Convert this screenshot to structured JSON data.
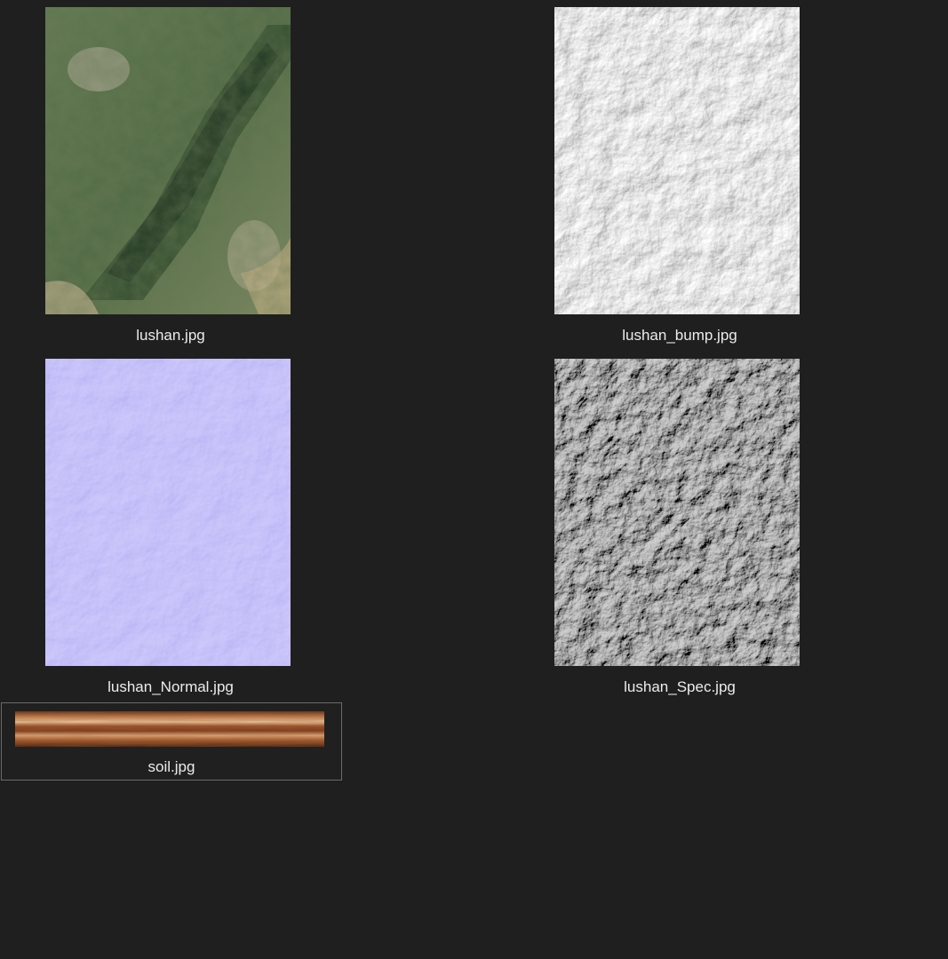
{
  "files": [
    {
      "name": "lushan.jpg",
      "thumbnail": "satellite terrain image",
      "selected": false
    },
    {
      "name": "lushan_bump.jpg",
      "thumbnail": "grayscale bump map",
      "selected": false
    },
    {
      "name": "lushan_Normal.jpg",
      "thumbnail": "blue-purple normal map",
      "selected": false
    },
    {
      "name": "lushan_Spec.jpg",
      "thumbnail": "gray specular map",
      "selected": false
    },
    {
      "name": "soil.jpg",
      "thumbnail": "brown soil strip texture",
      "selected": true
    }
  ],
  "colors": {
    "background": "#1f1f1f",
    "label_text": "#ececec",
    "selection_border": "#6a6a6a",
    "normal_map_base": "#6b6ff0",
    "soil_base": "#8a4424"
  }
}
